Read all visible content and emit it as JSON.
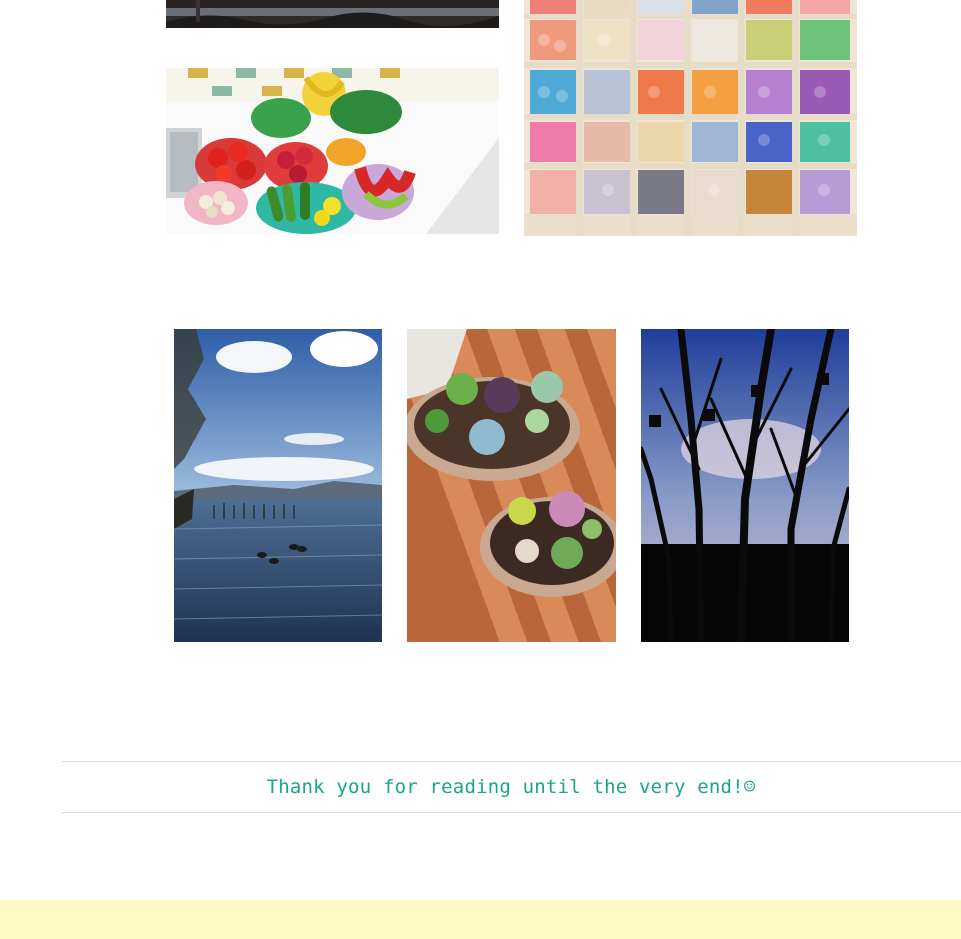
{
  "closing": {
    "message": "Thank you for reading until the very end!",
    "emoji": "☺"
  },
  "photos": {
    "top_left_strip": "photo-landscape-strip",
    "vegetables": "photo-vegetables",
    "yarn_shelf": "photo-yarn-shelf",
    "lake": "photo-lake",
    "succulents": "photo-succulents",
    "trees": "photo-trees"
  },
  "colors": {
    "accent_text": "#1aa58a",
    "footer_band": "#fff9c4",
    "divider": "#dcdcdc"
  }
}
